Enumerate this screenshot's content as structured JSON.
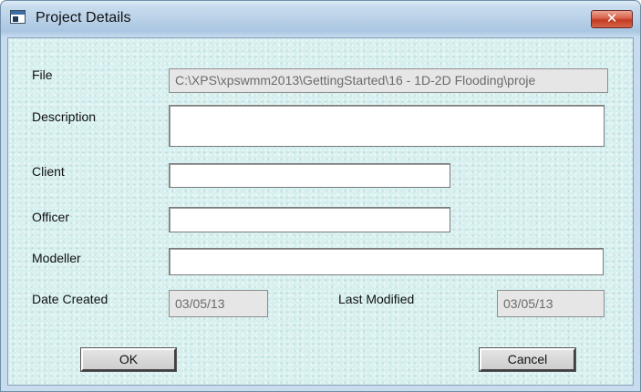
{
  "window": {
    "title": "Project Details",
    "close_glyph": "✕"
  },
  "form": {
    "file_label": "File",
    "file_value": "C:\\XPS\\xpswmm2013\\GettingStarted\\16 - 1D-2D Flooding\\proje",
    "description_label": "Description",
    "description_value": "",
    "client_label": "Client",
    "client_value": "",
    "officer_label": "Officer",
    "officer_value": "",
    "modeller_label": "Modeller",
    "modeller_value": "",
    "date_created_label": "Date Created",
    "date_created_value": "03/05/13",
    "last_modified_label": "Last Modified",
    "last_modified_value": "03/05/13"
  },
  "buttons": {
    "ok_label": "OK",
    "cancel_label": "Cancel"
  },
  "icons": {
    "app": "app-window-icon",
    "close": "close-icon"
  }
}
